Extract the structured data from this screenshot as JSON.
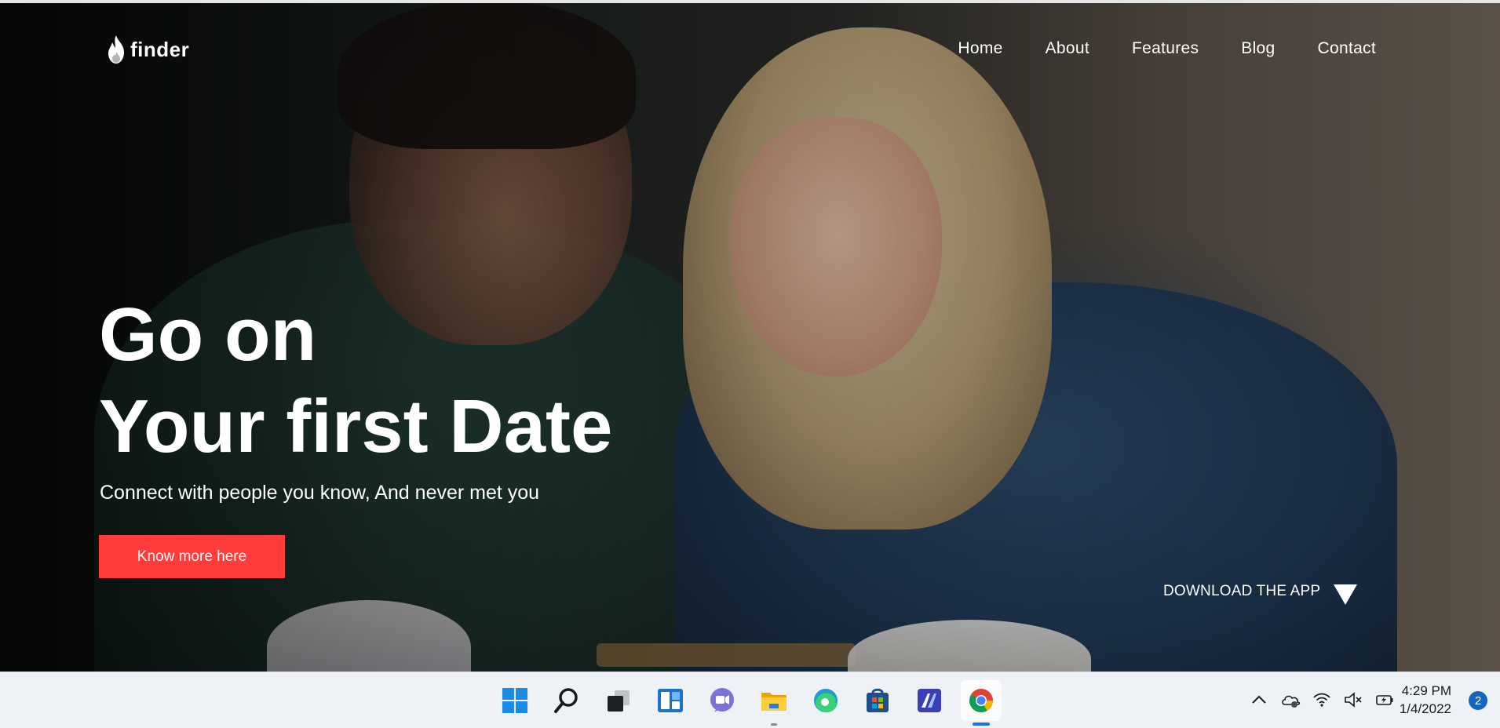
{
  "site": {
    "logo_text": "finder",
    "nav": [
      "Home",
      "About",
      "Features",
      "Blog",
      "Contact"
    ]
  },
  "hero": {
    "headline_line1": "Go on",
    "headline_line2": "Your first Date",
    "subtitle": "Connect with people you know, And never met you",
    "cta_label": "Know more here",
    "download_label": "DOWNLOAD THE APP"
  },
  "colors": {
    "accent": "#ff3b3b",
    "taskbar_bg": "#eef1f5"
  },
  "taskbar": {
    "apps": [
      "windows-start-icon",
      "search-icon",
      "task-view-icon",
      "widgets-icon",
      "teams-chat-icon",
      "file-explorer-icon",
      "edge-icon",
      "store-icon",
      "mail-app-icon",
      "chrome-icon"
    ],
    "tray": [
      "chevron-up-icon",
      "onedrive-icon",
      "wifi-icon",
      "volume-muted-icon",
      "battery-icon"
    ],
    "time": "4:29 PM",
    "date": "1/4/2022",
    "notification_count": "2"
  }
}
